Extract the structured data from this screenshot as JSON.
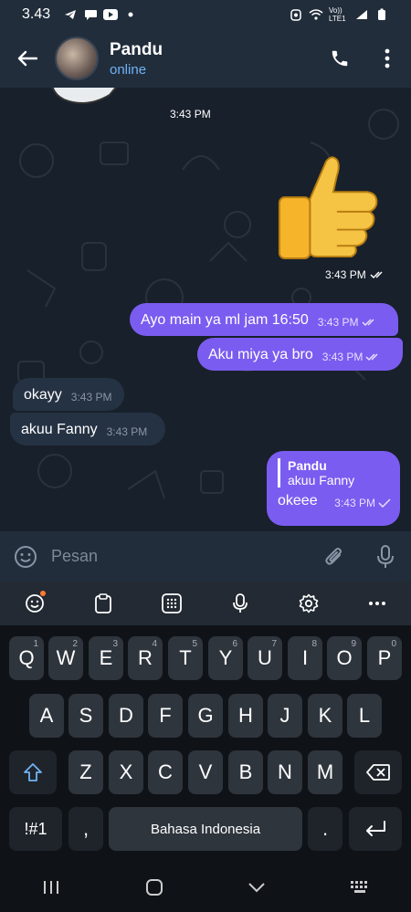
{
  "status_bar": {
    "time": "3.43",
    "network": "Vo)) LTE1"
  },
  "header": {
    "contact_name": "Pandu",
    "contact_status": "online"
  },
  "chat": {
    "sticker_time": "3:43 PM",
    "thumb_time": "3:43 PM",
    "messages": [
      {
        "text": "Ayo main ya ml jam 16:50",
        "time": "3:43 PM",
        "direction": "out"
      },
      {
        "text": "Aku miya ya bro",
        "time": "3:43 PM",
        "direction": "out"
      },
      {
        "text": "okayy",
        "time": "3:43 PM",
        "direction": "in"
      },
      {
        "text": "akuu Fanny",
        "time": "3:43 PM",
        "direction": "in"
      },
      {
        "reply_name": "Pandu",
        "reply_text": "akuu Fanny",
        "text": "okeee",
        "time": "3:43 PM",
        "direction": "out"
      }
    ]
  },
  "input": {
    "placeholder": "Pesan"
  },
  "keyboard": {
    "row1": [
      "Q",
      "W",
      "E",
      "R",
      "T",
      "Y",
      "U",
      "I",
      "O",
      "P"
    ],
    "row1_hints": [
      "1",
      "2",
      "3",
      "4",
      "5",
      "6",
      "7",
      "8",
      "9",
      "0"
    ],
    "row2": [
      "A",
      "S",
      "D",
      "F",
      "G",
      "H",
      "J",
      "K",
      "L"
    ],
    "row3": [
      "Z",
      "X",
      "C",
      "V",
      "B",
      "N",
      "M"
    ],
    "symbols_label": "!#1",
    "comma_label": ",",
    "space_label": "Bahasa Indonesia",
    "period_label": "."
  },
  "colors": {
    "outgoing": "#7b5cf0",
    "incoming": "#253243",
    "accent": "#6fb3f5"
  }
}
